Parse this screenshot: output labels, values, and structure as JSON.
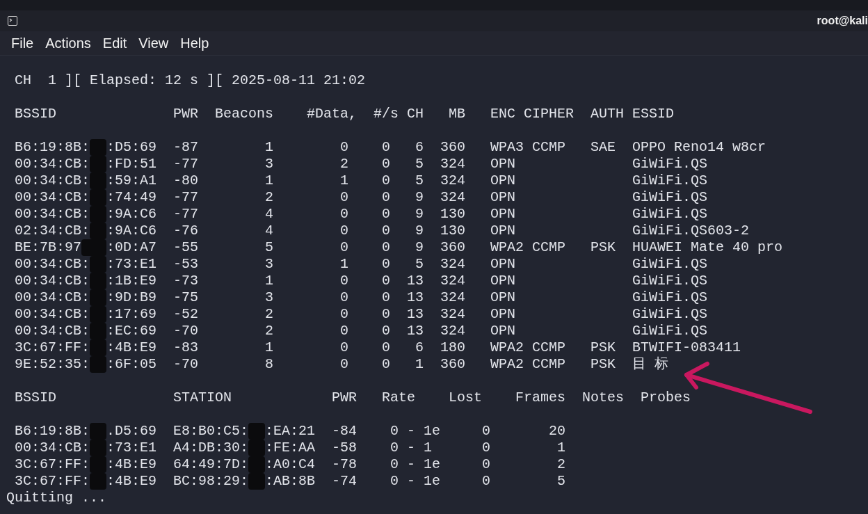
{
  "window": {
    "title": "root@kali"
  },
  "menu": [
    "File",
    "Actions",
    "Edit",
    "View",
    "Help"
  ],
  "status_line": "CH  1 ][ Elapsed: 12 s ][ 2025-08-11 21:02",
  "access_points": {
    "columns": [
      "BSSID",
      "PWR",
      "Beacons",
      "#Data,",
      "#/s",
      "CH",
      "MB",
      "ENC",
      "CIPHER",
      "AUTH",
      "ESSID"
    ],
    "rows": [
      {
        "bssid_start": "B6:19:8B:",
        "bssid_end": ":D5:69",
        "pwr": "-87",
        "beacons": "1",
        "data": "0",
        "per_s": "0",
        "ch": "6",
        "mb": "360",
        "enc": "WPA3",
        "cipher": "CCMP",
        "auth": "SAE",
        "essid": "OPPO Reno14 w8cr"
      },
      {
        "bssid_start": "00:34:CB:",
        "bssid_end": ":FD:51",
        "pwr": "-77",
        "beacons": "3",
        "data": "2",
        "per_s": "0",
        "ch": "5",
        "mb": "324",
        "enc": "OPN",
        "essid": "GiWiFi.QS"
      },
      {
        "bssid_start": "00:34:CB:",
        "bssid_end": ":59:A1",
        "pwr": "-80",
        "beacons": "1",
        "data": "1",
        "per_s": "0",
        "ch": "5",
        "mb": "324",
        "enc": "OPN",
        "essid": "GiWiFi.QS"
      },
      {
        "bssid_start": "00:34:CB:",
        "bssid_end": ":74:49",
        "pwr": "-77",
        "beacons": "2",
        "data": "0",
        "per_s": "0",
        "ch": "9",
        "mb": "324",
        "enc": "OPN",
        "essid": "GiWiFi.QS"
      },
      {
        "bssid_start": "00:34:CB:",
        "bssid_end": ":9A:C6",
        "pwr": "-77",
        "beacons": "4",
        "data": "0",
        "per_s": "0",
        "ch": "9",
        "mb": "130",
        "enc": "OPN",
        "essid": "GiWiFi.QS"
      },
      {
        "bssid_start": "02:34:CB:",
        "bssid_end": ":9A:C6",
        "pwr": "-76",
        "beacons": "4",
        "data": "0",
        "per_s": "0",
        "ch": "9",
        "mb": "130",
        "enc": "OPN",
        "essid": "GiWiFi.QS603-2"
      },
      {
        "bssid_start": "BE:7B:97",
        "bssid_end": ":0D:A7",
        "pwr": "-55",
        "beacons": "5",
        "data": "0",
        "per_s": "0",
        "ch": "9",
        "mb": "360",
        "enc": "WPA2",
        "cipher": "CCMP",
        "auth": "PSK",
        "essid": "HUAWEI Mate 40 pro"
      },
      {
        "bssid_start": "00:34:CB:",
        "bssid_end": ":73:E1",
        "pwr": "-53",
        "beacons": "3",
        "data": "1",
        "per_s": "0",
        "ch": "5",
        "mb": "324",
        "enc": "OPN",
        "essid": "GiWiFi.QS"
      },
      {
        "bssid_start": "00:34:CB:",
        "bssid_end": ":1B:E9",
        "pwr": "-73",
        "beacons": "1",
        "data": "0",
        "per_s": "0",
        "ch": "13",
        "mb": "324",
        "enc": "OPN",
        "essid": "GiWiFi.QS"
      },
      {
        "bssid_start": "00:34:CB:",
        "bssid_end": ":9D:B9",
        "pwr": "-75",
        "beacons": "3",
        "data": "0",
        "per_s": "0",
        "ch": "13",
        "mb": "324",
        "enc": "OPN",
        "essid": "GiWiFi.QS"
      },
      {
        "bssid_start": "00:34:CB:",
        "bssid_end": ":17:69",
        "pwr": "-52",
        "beacons": "2",
        "data": "0",
        "per_s": "0",
        "ch": "13",
        "mb": "324",
        "enc": "OPN",
        "essid": "GiWiFi.QS"
      },
      {
        "bssid_start": "00:34:CB:",
        "bssid_end": ":EC:69",
        "pwr": "-70",
        "beacons": "2",
        "data": "0",
        "per_s": "0",
        "ch": "13",
        "mb": "324",
        "enc": "OPN",
        "essid": "GiWiFi.QS"
      },
      {
        "bssid_start": "3C:67:FF:",
        "bssid_end": ":4B:E9",
        "pwr": "-83",
        "beacons": "1",
        "data": "0",
        "per_s": "0",
        "ch": "6",
        "mb": "180",
        "enc": "WPA2",
        "cipher": "CCMP",
        "auth": "PSK",
        "essid": "BTWIFI-083411"
      },
      {
        "bssid_start": "9E:52:35:",
        "bssid_end": ":6F:05",
        "pwr": "-70",
        "beacons": "8",
        "data": "0",
        "per_s": "0",
        "ch": "1",
        "mb": "360",
        "enc": "WPA2",
        "cipher": "CCMP",
        "auth": "PSK",
        "essid": "目 标"
      }
    ]
  },
  "stations": {
    "columns": [
      "BSSID",
      "STATION",
      "PWR",
      "Rate",
      "Lost",
      "Frames",
      "Notes",
      "Probes"
    ],
    "rows": [
      {
        "bssid_start": "B6:19:8B:",
        "bssid_end": ".D5:69",
        "station_start": "E8:B0:C5:",
        "station_end": ":EA:21",
        "pwr": "-84",
        "rate": "0 - 1e",
        "lost": "0",
        "frames": "20"
      },
      {
        "bssid_start": "00:34:CB:",
        "bssid_end": ":73:E1",
        "station_start": "A4:DB:30:",
        "station_end": ":FE:AA",
        "pwr": "-58",
        "rate": "0 - 1",
        "lost": "0",
        "frames": "1"
      },
      {
        "bssid_start": "3C:67:FF:",
        "bssid_end": ":4B:E9",
        "station_start": "64:49:7D:",
        "station_end": ":A0:C4",
        "pwr": "-78",
        "rate": "0 - 1e",
        "lost": "0",
        "frames": "2"
      },
      {
        "bssid_start": "3C:67:FF:",
        "bssid_end": ":4B:E9",
        "station_start": "BC:98:29:",
        "station_end": ":AB:8B",
        "pwr": "-74",
        "rate": "0 - 1e",
        "lost": "0",
        "frames": "5"
      }
    ]
  },
  "footer": "Quitting ..."
}
